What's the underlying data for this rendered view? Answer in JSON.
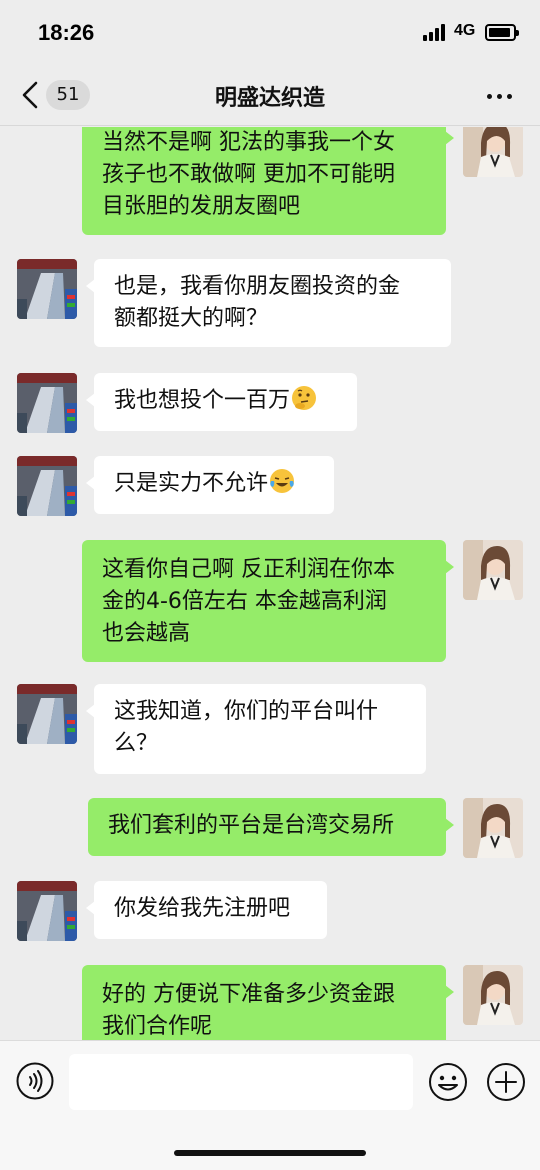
{
  "status_bar": {
    "time": "18:26",
    "network": "4G"
  },
  "nav": {
    "unread_count": "51",
    "title": "明盛达织造"
  },
  "messages": [
    {
      "side": "out",
      "lines": [
        "当然不是啊 犯法的事我一个女",
        "孩子也不敢做啊 更加不可能明",
        "目张胆的发朋友圈吧"
      ]
    },
    {
      "side": "in",
      "lines": [
        "也是，我看你朋友圈投资的金",
        "额都挺大的啊？"
      ]
    },
    {
      "side": "in",
      "lines": [
        "我也想投个一百万"
      ],
      "emoji": "thinking-face"
    },
    {
      "side": "in",
      "lines": [
        "只是实力不允许"
      ],
      "emoji": "laughing-tears-face"
    },
    {
      "side": "out",
      "lines": [
        "这看你自己啊 反正利润在你本",
        "金的4-6倍左右 本金越高利润",
        "也会越高"
      ]
    },
    {
      "side": "in",
      "lines": [
        "这我知道，你们的平台叫什",
        "么？"
      ]
    },
    {
      "side": "out",
      "lines": [
        "我们套利的平台是台湾交易所"
      ]
    },
    {
      "side": "in",
      "lines": [
        "你发给我先注册吧"
      ]
    },
    {
      "side": "out",
      "lines": [
        "好的 方便说下准备多少资金跟",
        "我们合作呢"
      ]
    }
  ],
  "input": {
    "placeholder": ""
  },
  "colors": {
    "outgoing_bubble": "#95ec69",
    "incoming_bubble": "#ffffff",
    "background": "#ededed"
  },
  "icons": {
    "back": "chevron-left-icon",
    "more": "more-dots-icon",
    "voice": "voice-icon",
    "emoji": "emoji-icon",
    "plus": "plus-icon"
  }
}
